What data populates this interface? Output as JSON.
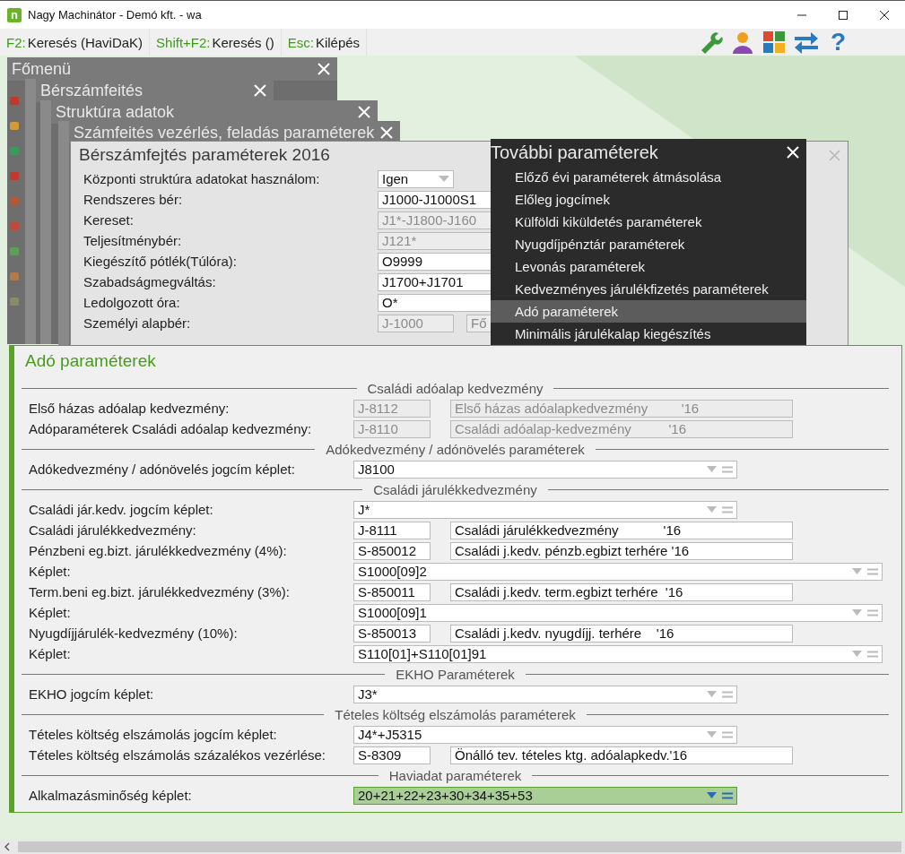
{
  "window": {
    "title": "Nagy Machinátor - Demó kft. - wa",
    "logo": "n"
  },
  "toolbar": {
    "shortcuts": [
      {
        "key": "F2:",
        "label": "Keresés (HaviDaK)"
      },
      {
        "key": "Shift+F2:",
        "label": "Keresés ()"
      },
      {
        "key": "Esc:",
        "label": "Kilépés"
      }
    ],
    "help": "?"
  },
  "stacked_windows": [
    {
      "title": "Főmenü"
    },
    {
      "title": "Bérszámfeités"
    },
    {
      "title": "Struktúra adatok"
    },
    {
      "title": "Számfeités vezérlés, feladás paraméterek"
    }
  ],
  "params_window": {
    "title": "Bérszámfejtés paraméterek 2016",
    "rows": [
      {
        "label": "Központi struktúra adatokat használom:",
        "kind": "select",
        "value": "Igen",
        "disabled": false
      },
      {
        "label": "Rendszeres bér:",
        "kind": "field",
        "value": "J1000-J1000S1",
        "disabled": false
      },
      {
        "label": "Kereset:",
        "kind": "field",
        "value": "J1*-J1800-J160",
        "disabled": true
      },
      {
        "label": "Teljesítménybér:",
        "kind": "field",
        "value": "J121*",
        "disabled": true
      },
      {
        "label": "Kiegészítő pótlék(Túlóra):",
        "kind": "field",
        "value": "O9999",
        "disabled": false
      },
      {
        "label": "Szabadságmegváltás:",
        "kind": "field",
        "value": "J1700+J1701",
        "disabled": false
      },
      {
        "label": "Ledolgozott óra:",
        "kind": "field",
        "value": "O*",
        "disabled": false
      },
      {
        "label": "Személyi alapbér:",
        "kind": "pair",
        "value": "J-1000",
        "value2": "Fő",
        "disabled": true
      }
    ]
  },
  "menu": {
    "title": "További paraméterek",
    "items": [
      {
        "label": "Előző évi paraméterek átmásolása",
        "selected": false
      },
      {
        "label": "Előleg jogcímek",
        "selected": false
      },
      {
        "label": "Külföldi kiküldetés paraméterek",
        "selected": false
      },
      {
        "label": "Nyugdíjpénztár paraméterek",
        "selected": false
      },
      {
        "label": "Levonás paraméterek",
        "selected": false
      },
      {
        "label": "Kedvezményes járulékfizetés paraméterek",
        "selected": false
      },
      {
        "label": "Adó paraméterek",
        "selected": true
      },
      {
        "label": "Minimális járulékalap kiegészítés",
        "selected": false
      }
    ]
  },
  "panel": {
    "title": "Adó paraméterek",
    "sections": [
      {
        "title": "Családi adóalap kedvezmény",
        "rows": [
          {
            "label": "Első házas adóalap kedvezmény:",
            "kind": "pair",
            "code": "J-8112",
            "description": "Első házas adóalapkedvezmény         '16",
            "disabled": true
          },
          {
            "label": "Adóparaméterek Családi adóalap kedvezmény:",
            "kind": "pair",
            "code": "J-8110",
            "description": "Családi adóalap-kedvezmény          '16",
            "disabled": true
          }
        ]
      },
      {
        "title": "Adókedvezmény / adónövelés paraméterek",
        "rows": [
          {
            "label": "Adókedvezmény / adónövelés jogcím képlet:",
            "kind": "formula",
            "value": "J8100",
            "focused": false
          }
        ]
      },
      {
        "title": "Családi járulékkedvezmény",
        "rows": [
          {
            "label": "Családi jár.kedv. jogcím képlet:",
            "kind": "formula",
            "value": "J*",
            "focused": false
          },
          {
            "label": "Családi járulékkedvezmény:",
            "kind": "pair",
            "code": "J-8111",
            "description": "Családi járulékkedvezmény            '16",
            "disabled": false
          },
          {
            "label": "Pénzbeni eg.bizt. járulékkedvezmény (4%):",
            "kind": "pair",
            "code": "S-850012",
            "description": "Családi j.kedv. pénzb.egbizt terhére '16",
            "disabled": false
          },
          {
            "label": "Képlet:",
            "kind": "subformula",
            "value": "S1000[09]2",
            "focused": false
          },
          {
            "label": "Term.beni eg.bizt. járulékkedvezmény (3%):",
            "kind": "pair",
            "code": "S-850011",
            "description": "Családi j.kedv. term.egbizt terhére  '16",
            "disabled": false
          },
          {
            "label": "Képlet:",
            "kind": "subformula",
            "value": "S1000[09]1",
            "focused": false
          },
          {
            "label": "Nyugdíjjárulék-kedvezmény (10%):",
            "kind": "pair",
            "code": "S-850013",
            "description": "Családi j.kedv. nyugdíjj. terhére    '16",
            "disabled": false
          },
          {
            "label": "Képlet:",
            "kind": "subformula",
            "value": "S110[01]+S110[01]91",
            "focused": false
          }
        ]
      },
      {
        "title": "EKHO Paraméterek",
        "rows": [
          {
            "label": "EKHO jogcím képlet:",
            "kind": "formula",
            "value": "J3*",
            "focused": false
          }
        ]
      },
      {
        "title": "Tételes költség elszámolás paraméterek",
        "rows": [
          {
            "label": "Tételes költség elszámolás jogcím képlet:",
            "kind": "formula",
            "value": "J4*+J5315",
            "focused": false
          },
          {
            "label": "Tételes költség elszámolás százalékos vezérlése:",
            "kind": "pair",
            "code": "S-8309",
            "description": "Önálló tev. tételes ktg. adóalapkedv.'16",
            "disabled": false
          }
        ]
      },
      {
        "title": "Haviadat paraméterek",
        "rows": [
          {
            "label": "Alkalmazásminőség képlet:",
            "kind": "formula",
            "value": "20+21+22+23+30+34+35+53",
            "focused": true
          }
        ]
      }
    ]
  }
}
